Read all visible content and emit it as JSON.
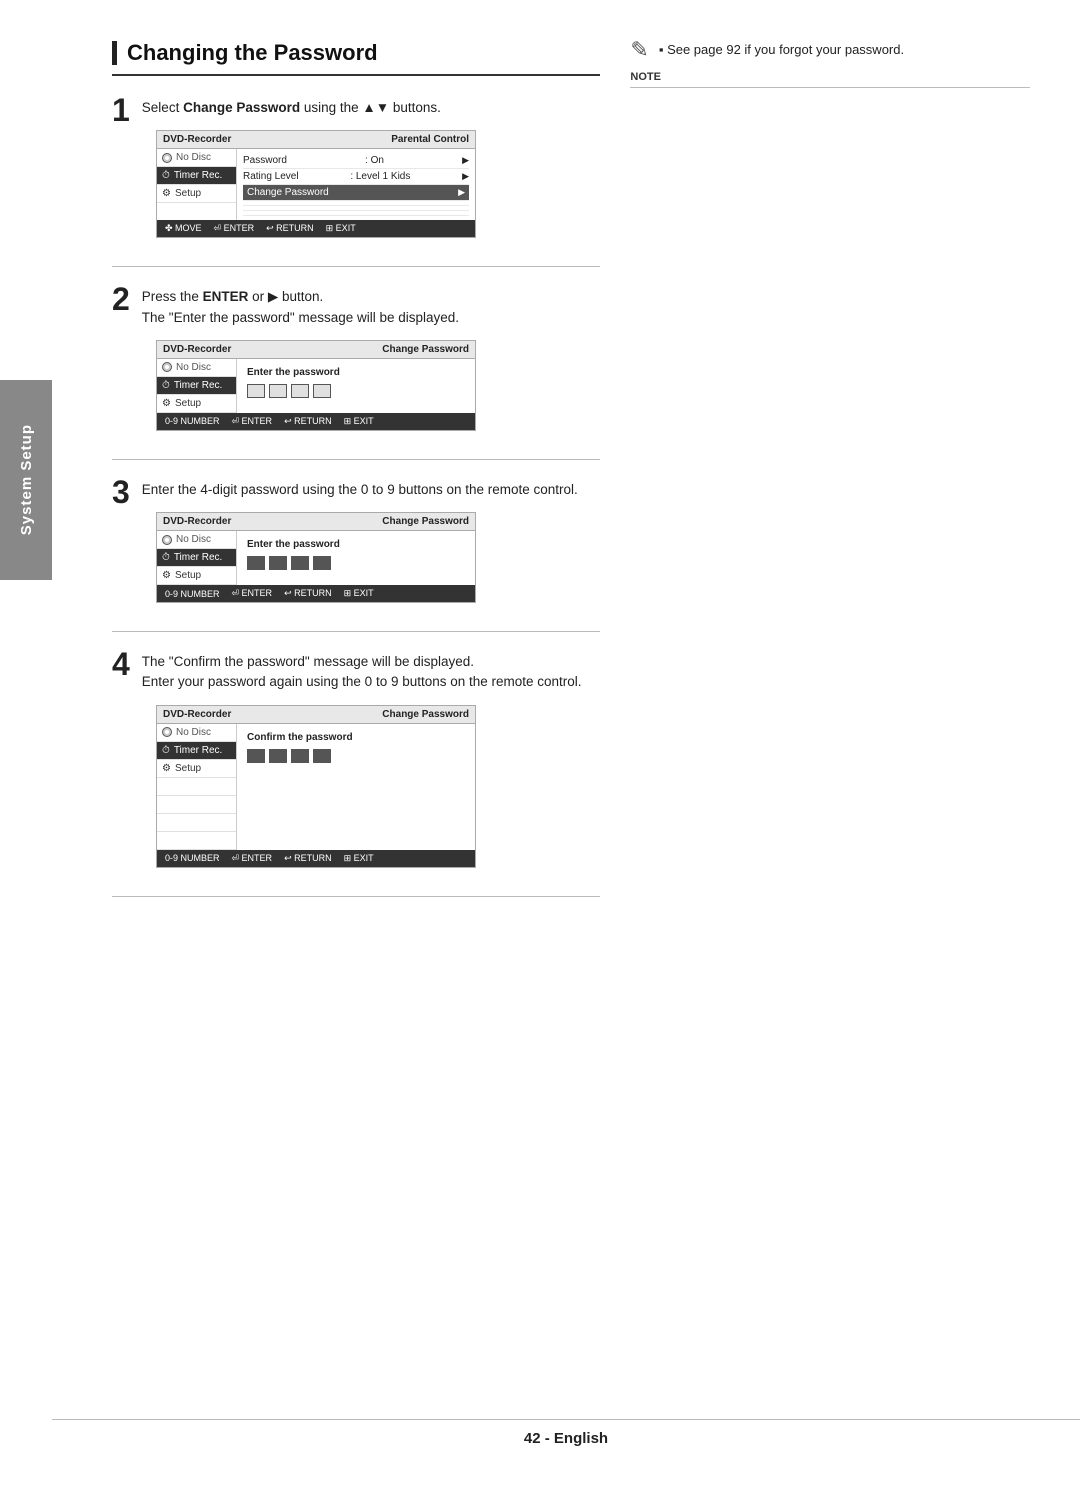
{
  "page": {
    "title": "Changing the Password",
    "footer": "42 - English"
  },
  "sidebar": {
    "label": "System Setup"
  },
  "note": {
    "icon": "🖊",
    "text": "▪  See page 92 if you forgot your password.",
    "label": "NOTE"
  },
  "steps": [
    {
      "number": "1",
      "text_before": "Select ",
      "bold_text": "Change Password",
      "text_after": " using the ▲▼ buttons.",
      "screen": {
        "header_left": "DVD-Recorder",
        "header_right": "Parental Control",
        "menu_items": [
          {
            "label": "No Disc",
            "type": "nodisc"
          },
          {
            "label": "Timer Rec.",
            "type": "active"
          },
          {
            "label": "Setup",
            "type": "gear"
          }
        ],
        "rows": [
          {
            "left": "Password",
            "right": ": On",
            "has_arrow": true
          },
          {
            "left": "Rating Level",
            "right": ": Level 1 Kids",
            "has_arrow": true
          },
          {
            "left": "Change Password",
            "right": "",
            "has_arrow": true,
            "selected": true
          }
        ],
        "footer_items": [
          "✤ MOVE",
          "⏎ ENTER",
          "↩ RETURN",
          "⊞ EXIT"
        ]
      }
    },
    {
      "number": "2",
      "text_before": "Press the ",
      "bold_text": "ENTER",
      "text_after": " or ▶ button.",
      "sub_text": "The \"Enter the password\" message will be displayed.",
      "screen": {
        "header_left": "DVD-Recorder",
        "header_right": "Change Password",
        "menu_items": [
          {
            "label": "No Disc",
            "type": "nodisc"
          },
          {
            "label": "Timer Rec.",
            "type": "active"
          },
          {
            "label": "Setup",
            "type": "gear"
          }
        ],
        "password_label": "Enter the password",
        "password_boxes": [
          false,
          false,
          false,
          false
        ],
        "footer_items": [
          "0-9 NUMBER",
          "⏎ ENTER",
          "↩ RETURN",
          "⊞ EXIT"
        ]
      }
    },
    {
      "number": "3",
      "text": "Enter the 4-digit password using the 0 to 9 buttons on the remote control.",
      "screen": {
        "header_left": "DVD-Recorder",
        "header_right": "Change Password",
        "menu_items": [
          {
            "label": "No Disc",
            "type": "nodisc"
          },
          {
            "label": "Timer Rec.",
            "type": "active"
          },
          {
            "label": "Setup",
            "type": "gear"
          }
        ],
        "password_label": "Enter the password",
        "password_boxes": [
          true,
          true,
          true,
          true
        ],
        "footer_items": [
          "0-9 NUMBER",
          "⏎ ENTER",
          "↩ RETURN",
          "⊞ EXIT"
        ]
      }
    },
    {
      "number": "4",
      "text_line1": "The \"Confirm the password\" message will be displayed.",
      "text_line2": "Enter your password again using the 0 to 9 buttons on the remote control.",
      "screen": {
        "header_left": "DVD-Recorder",
        "header_right": "Change Password",
        "menu_items": [
          {
            "label": "No Disc",
            "type": "nodisc"
          },
          {
            "label": "Timer Rec.",
            "type": "active"
          },
          {
            "label": "Setup",
            "type": "gear"
          }
        ],
        "password_label": "Confirm the password",
        "password_boxes": [
          true,
          true,
          true,
          true
        ],
        "footer_items": [
          "0-9 NUMBER",
          "⏎ ENTER",
          "↩ RETURN",
          "⊞ EXIT"
        ]
      }
    }
  ]
}
